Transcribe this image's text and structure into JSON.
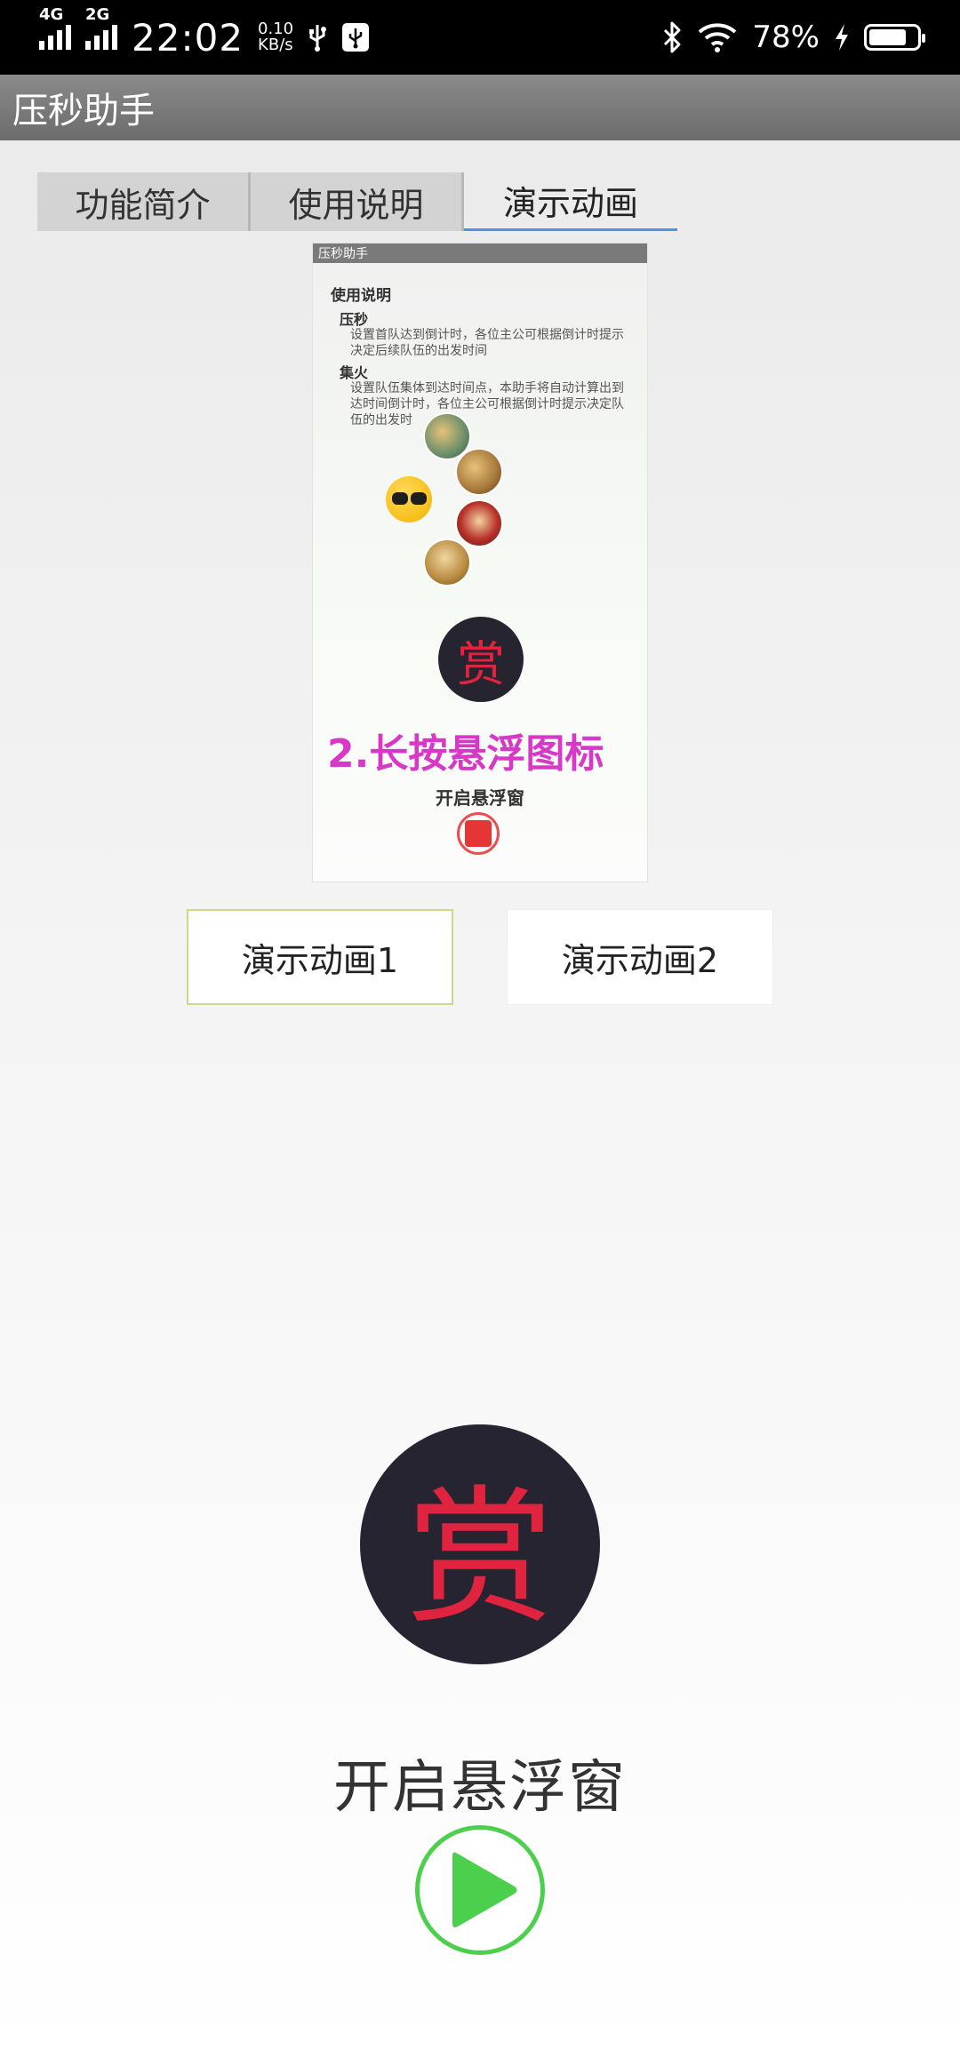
{
  "status_bar": {
    "net1": "4G",
    "net2": "2G",
    "time": "22:02",
    "speed_value": "0.10",
    "speed_unit": "KB/s",
    "battery_percent": "78%",
    "battery_level": 0.78,
    "icons": [
      "signal-4g-icon",
      "signal-2g-icon",
      "usb-icon",
      "usb-debug-icon",
      "bluetooth-icon",
      "wifi-icon",
      "charging-icon",
      "battery-icon"
    ]
  },
  "app": {
    "title": "压秒助手"
  },
  "tabs": [
    {
      "label": "功能简介",
      "active": false
    },
    {
      "label": "使用说明",
      "active": false
    },
    {
      "label": "演示动画",
      "active": true
    }
  ],
  "preview": {
    "bar_title": "压秒助手",
    "heading": "使用说明",
    "sec1_title": "压秒",
    "sec1_text": "设置首队达到倒计时，各位主公可根据倒计时提示决定后续队伍的出发时间",
    "sec2_title": "集火",
    "sec2_text": "设置队伍集体到达时间点，本助手将自动计算出到达时间倒计时，各位主公可根据倒计时提示决定队伍的出发时",
    "reward_char": "赏",
    "banner": "2.长按悬浮图标",
    "start_label": "开启悬浮窗"
  },
  "demo_buttons": {
    "demo1": "演示动画1",
    "demo2": "演示动画2"
  },
  "bottom": {
    "reward_char": "赏",
    "open_float_label": "开启悬浮窗"
  },
  "colors": {
    "accent_blue": "#4f91e6",
    "reward_red": "#e0243f",
    "reward_bg": "#26242f",
    "play_green": "#4ccf4c",
    "banner_magenta": "#d838c8"
  }
}
